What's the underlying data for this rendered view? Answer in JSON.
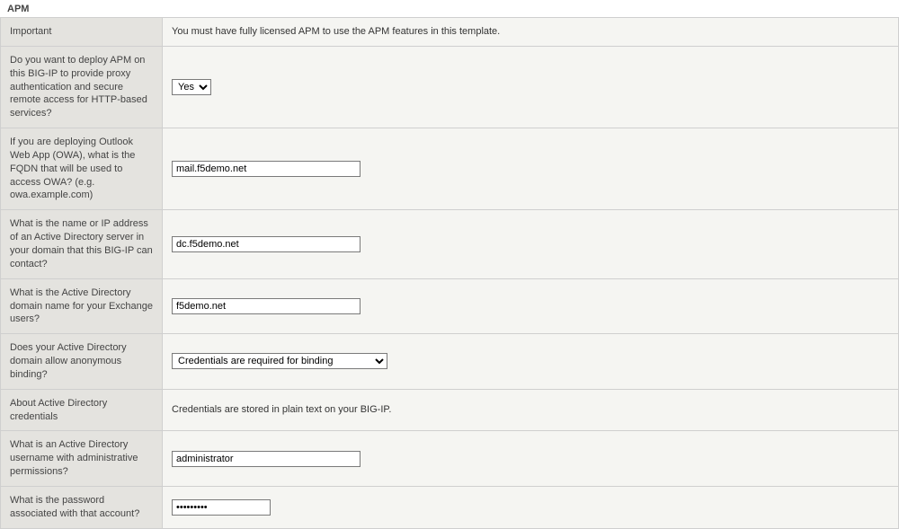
{
  "section": {
    "title": "APM"
  },
  "rows": {
    "important": {
      "label": "Important",
      "text": "You must have fully licensed APM to use the APM features in this template."
    },
    "deploy": {
      "label": "Do you want to deploy APM on this BIG-IP to provide proxy authentication and secure remote access for HTTP-based services?",
      "value": "Yes"
    },
    "fqdn": {
      "label": "If you are deploying Outlook Web App (OWA), what is the FQDN that will be used to access OWA? (e.g. owa.example.com)",
      "value": "mail.f5demo.net"
    },
    "ad_server": {
      "label": "What is the name or IP address of an Active Directory server in your domain that this BIG-IP can contact?",
      "value": "dc.f5demo.net"
    },
    "ad_domain": {
      "label": "What is the Active Directory domain name for your Exchange users?",
      "value": "f5demo.net"
    },
    "anon_bind": {
      "label": "Does your Active Directory domain allow anonymous binding?",
      "value": "Credentials are required for binding"
    },
    "creds_note": {
      "label": "About Active Directory credentials",
      "text": "Credentials are stored in plain text on your BIG-IP."
    },
    "ad_user": {
      "label": "What is an Active Directory username with administrative permissions?",
      "value": "administrator"
    },
    "ad_pass": {
      "label": "What is the password associated with that account?",
      "value": "•••••••••"
    }
  }
}
